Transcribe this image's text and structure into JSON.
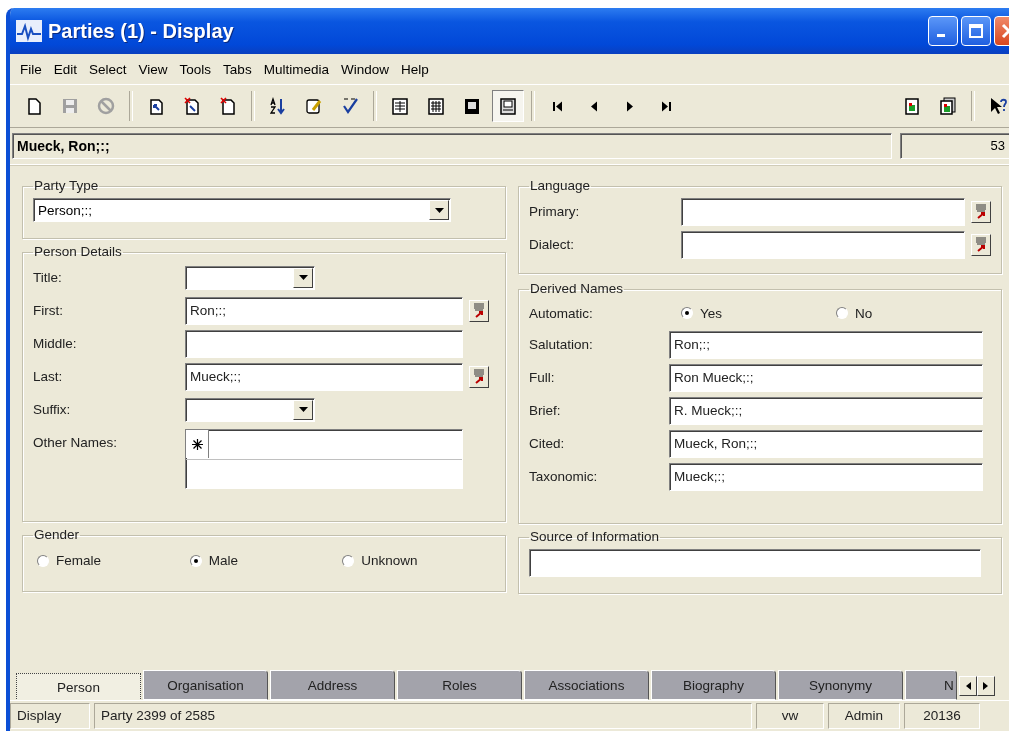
{
  "window": {
    "title": "Parties (1) - Display"
  },
  "menu": [
    "File",
    "Edit",
    "Select",
    "View",
    "Tools",
    "Tabs",
    "Multimedia",
    "Window",
    "Help"
  ],
  "toolbar": {
    "record_buttons": [
      {
        "disabled": false
      },
      {
        "disabled": true
      },
      {
        "disabled": true
      }
    ],
    "view_buttons": [
      {
        "selected": false
      },
      {
        "selected": false
      },
      {
        "selected": false
      },
      {
        "selected": true
      }
    ]
  },
  "record_bar": {
    "name": "Mueck, Ron;:;",
    "number": "53"
  },
  "party_type": {
    "label": "Party Type",
    "value": "Person;:;"
  },
  "person_details": {
    "label": "Person Details",
    "fields": [
      {
        "label": "Title:",
        "kind": "dropdown"
      },
      {
        "label": "First:",
        "kind": "lookup",
        "value": "Ron;:;"
      },
      {
        "label": "Middle:",
        "kind": "text"
      },
      {
        "label": "Last:",
        "kind": "lookup",
        "value": "Mueck;:;"
      },
      {
        "label": "Suffix:",
        "kind": "dropdown"
      },
      {
        "label": "Other Names:",
        "kind": "grid"
      }
    ]
  },
  "gender": {
    "label": "Gender",
    "options": [
      {
        "label": "Female",
        "selected": false
      },
      {
        "label": "Male",
        "selected": true
      },
      {
        "label": "Unknown",
        "selected": false
      }
    ]
  },
  "language": {
    "label": "Language",
    "fields": [
      {
        "label": "Primary:",
        "kind": "lookup"
      },
      {
        "label": "Dialect:",
        "kind": "lookup"
      }
    ]
  },
  "derived_names": {
    "label": "Derived Names",
    "automatic": {
      "label": "Automatic:",
      "options": [
        {
          "label": "Yes",
          "selected": true
        },
        {
          "label": "No",
          "selected": false
        }
      ]
    },
    "fields": [
      {
        "label": "Salutation:",
        "kind": "text",
        "value": "Ron;:;"
      },
      {
        "label": "Full:",
        "kind": "text",
        "value": "Ron Mueck;:;"
      },
      {
        "label": "Brief:",
        "kind": "text",
        "value": "R. Mueck;:;"
      },
      {
        "label": "Cited:",
        "kind": "text",
        "value": "Mueck, Ron;:;"
      },
      {
        "label": "Taxonomic:",
        "kind": "text",
        "value": "Mueck;:;"
      }
    ]
  },
  "source": {
    "label": "Source of Information"
  },
  "tabs": [
    {
      "label": "Person",
      "selected": true
    },
    {
      "label": "Organisation",
      "selected": false
    },
    {
      "label": "Address",
      "selected": false
    },
    {
      "label": "Roles",
      "selected": false
    },
    {
      "label": "Associations",
      "selected": false
    },
    {
      "label": "Biography",
      "selected": false
    },
    {
      "label": "Synonymy",
      "selected": false
    },
    {
      "label": "N",
      "selected": false
    }
  ],
  "status_bar": [
    "Display",
    "Party 2399 of 2585",
    "vw",
    "Admin",
    "20136"
  ]
}
